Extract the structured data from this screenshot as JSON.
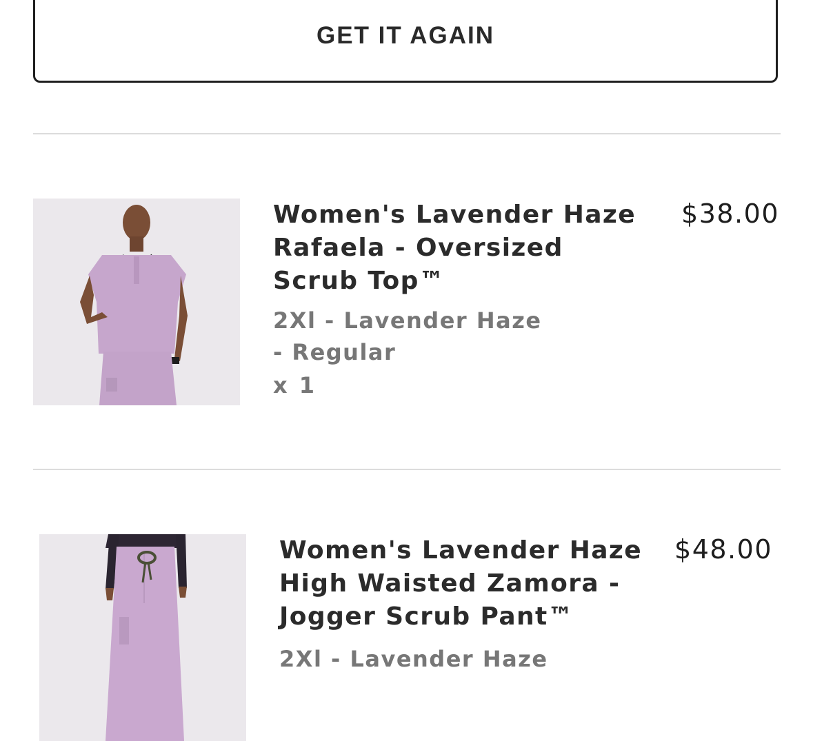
{
  "actions": {
    "get_it_again_label": "GET IT AGAIN"
  },
  "items": [
    {
      "title": "Women's Lavender Haze Rafaela - Oversized Scrub Top™",
      "variant": "2Xl - Lavender Haze - Regular",
      "quantity": "x 1",
      "price": "$38.00"
    },
    {
      "title": "Women's Lavender Haze High Waisted Zamora - Jogger Scrub Pant™",
      "variant": "2Xl - Lavender Haze",
      "price": "$48.00"
    }
  ],
  "colors": {
    "product_color": "#c9a7cf",
    "image_background": "#e9e5e9"
  }
}
